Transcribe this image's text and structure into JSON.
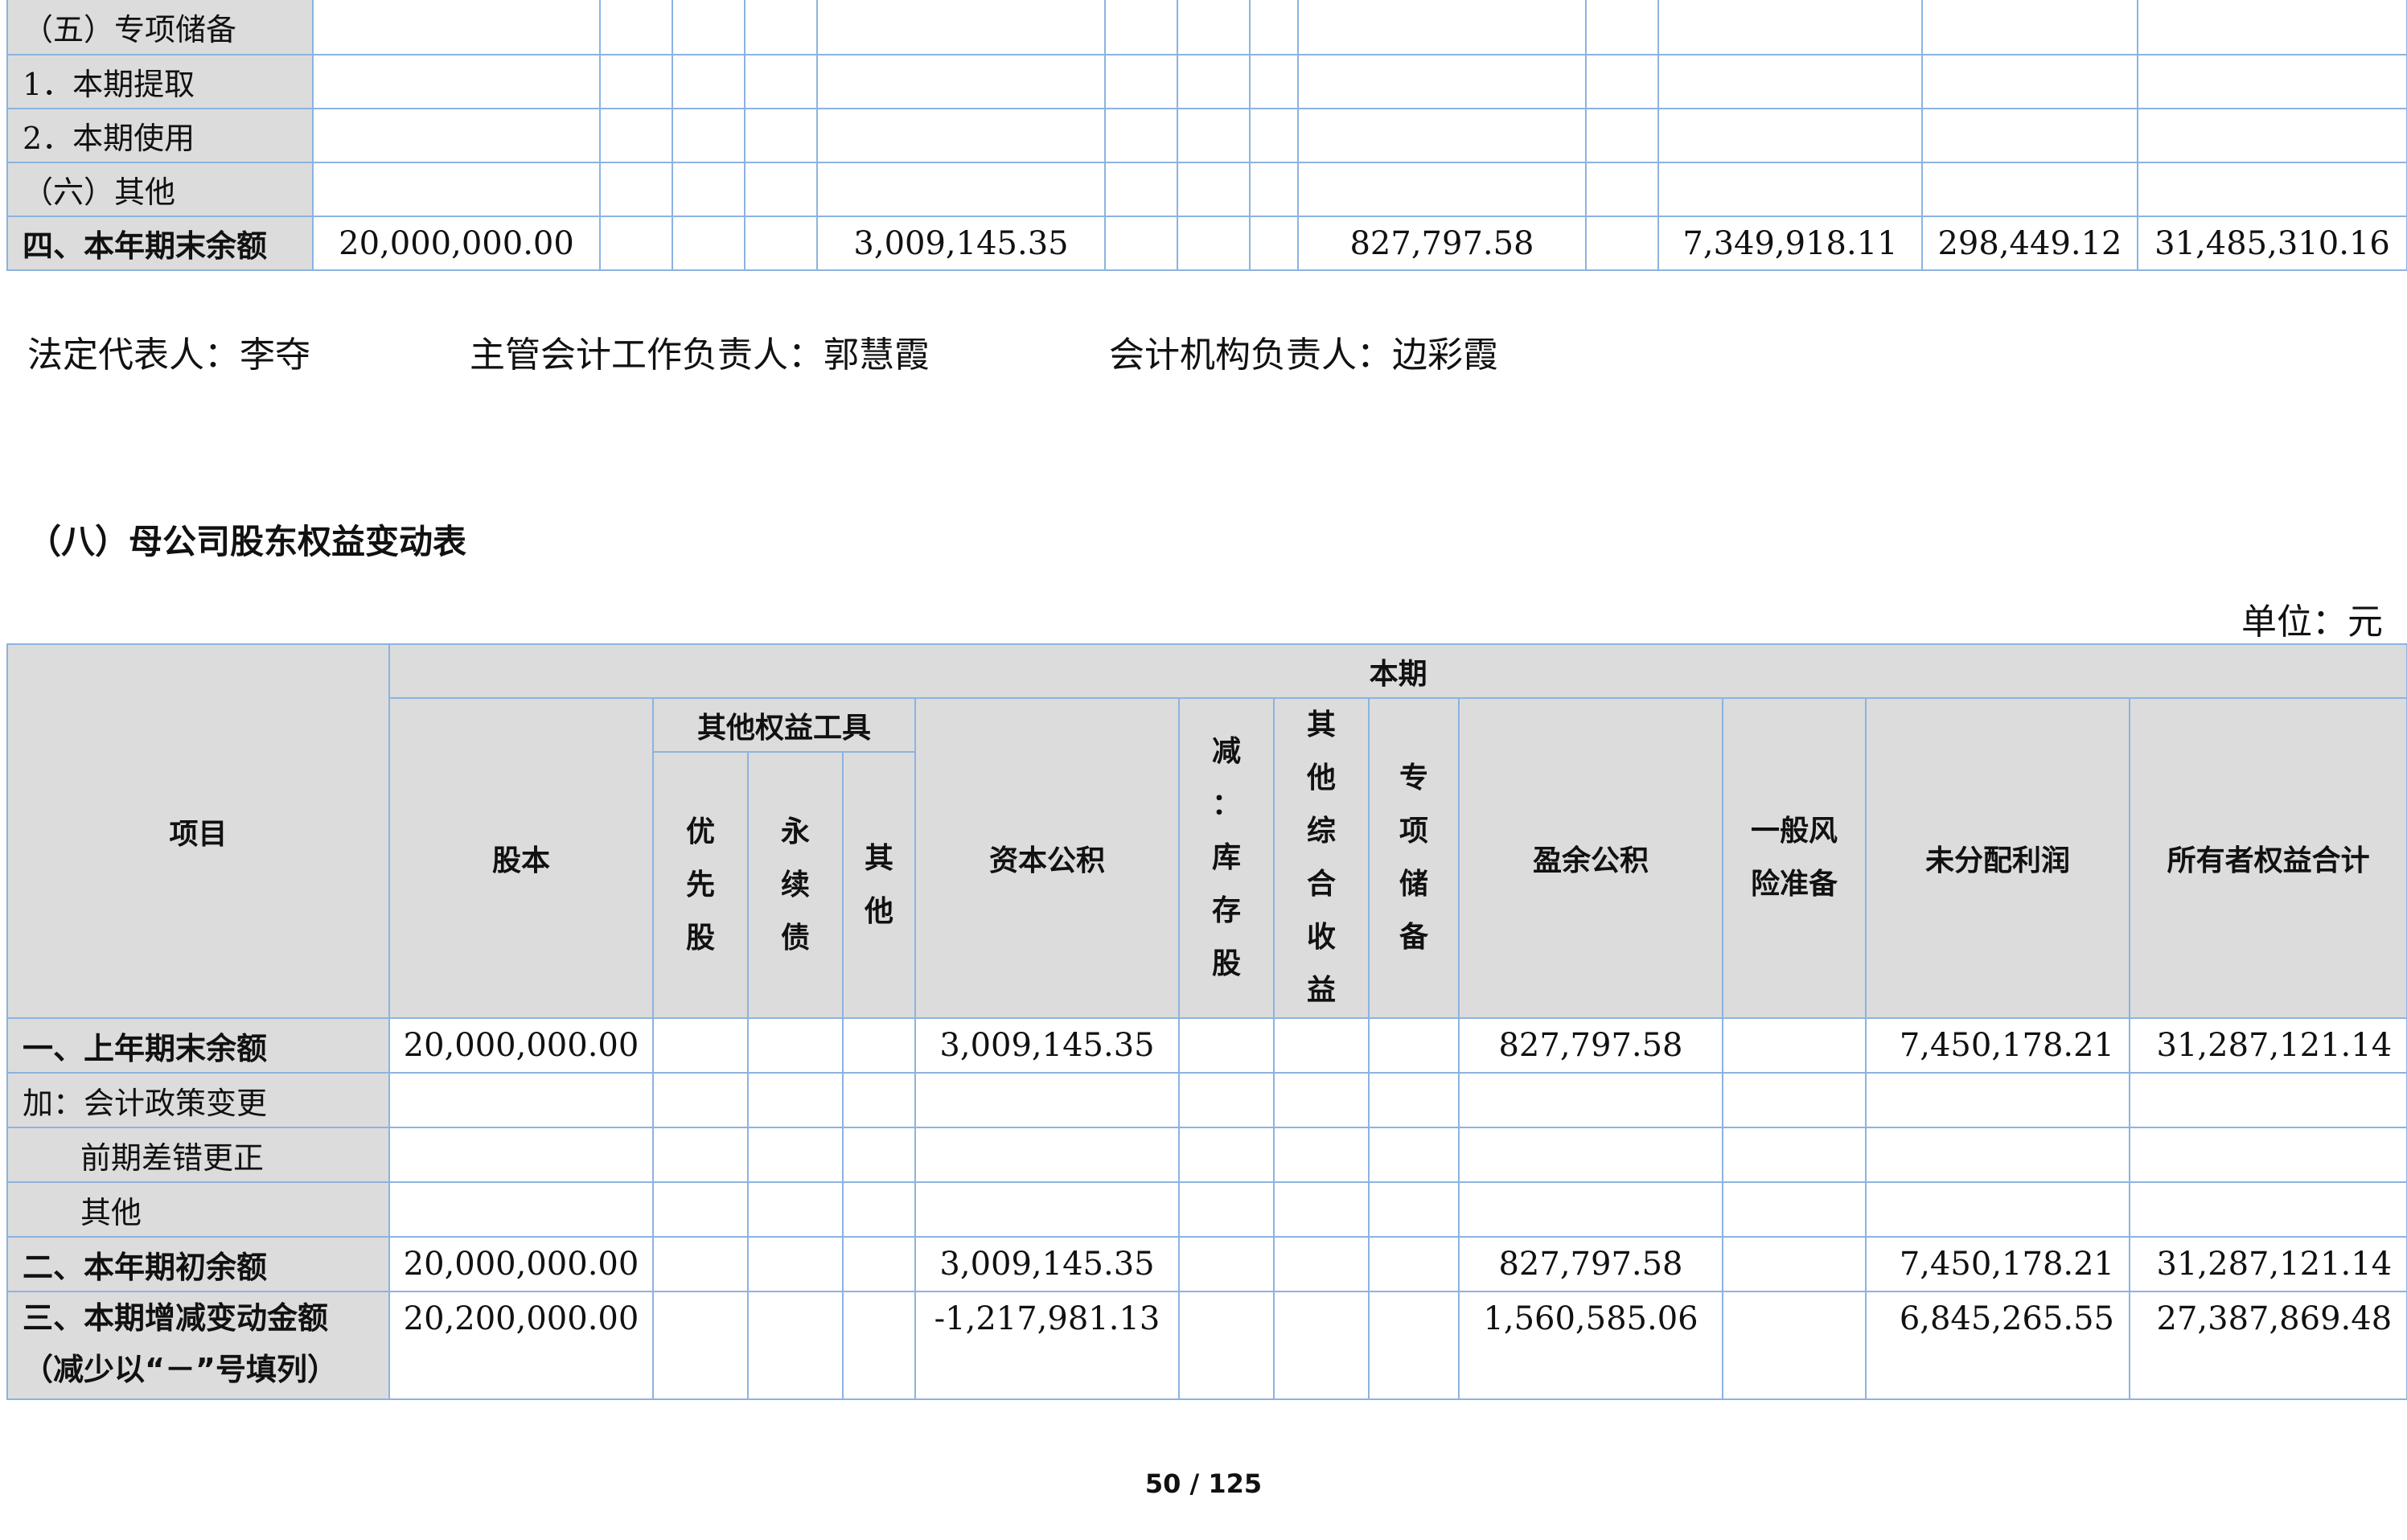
{
  "top_table": {
    "rows": [
      {
        "label": "（五）专项储备",
        "values": [
          "",
          "",
          "",
          "",
          "",
          "",
          "",
          "",
          "",
          "",
          "",
          "",
          ""
        ]
      },
      {
        "label": "1．本期提取",
        "values": [
          "",
          "",
          "",
          "",
          "",
          "",
          "",
          "",
          "",
          "",
          "",
          "",
          ""
        ]
      },
      {
        "label": "2．本期使用",
        "values": [
          "",
          "",
          "",
          "",
          "",
          "",
          "",
          "",
          "",
          "",
          "",
          "",
          ""
        ]
      },
      {
        "label": "（六）其他",
        "values": [
          "",
          "",
          "",
          "",
          "",
          "",
          "",
          "",
          "",
          "",
          "",
          "",
          ""
        ]
      },
      {
        "label": "四、本年期末余额",
        "values": [
          "20,000,000.00",
          "",
          "",
          "",
          "3,009,145.35",
          "",
          "",
          "",
          "827,797.58",
          "",
          "7,349,918.11",
          "298,449.12",
          "31,485,310.16"
        ]
      }
    ]
  },
  "signers": {
    "legal_rep": "法定代表人：李夺",
    "accounting_head": "主管会计工作负责人：郭慧霞",
    "accounting_org_head": "会计机构负责人：边彩霞"
  },
  "section": {
    "title": "（八）母公司股东权益变动表",
    "unit": "单位：元"
  },
  "main_table": {
    "headers": {
      "item": "项目",
      "period": "本期",
      "share_capital": "股本",
      "other_equity_tools": "其他权益工具",
      "preferred": "优\n先\n股",
      "perpetual": "永\n续\n债",
      "other_tool": "其\n他",
      "capital_reserve": "资本公积",
      "treasury": "减\n：\n库\n存\n股",
      "oci": "其\n他\n综\n合\n收\n益",
      "special_reserve": "专\n项\n储\n备",
      "surplus_reserve": "盈余公积",
      "general_risk": "一般风\n险准备",
      "undistributed": "未分配利润",
      "total_equity": "所有者权益合计"
    },
    "rows": [
      {
        "label": "一、上年期末余额",
        "values": [
          "20,000,000.00",
          "",
          "",
          "",
          "3,009,145.35",
          "",
          "",
          "",
          "827,797.58",
          "",
          "7,450,178.21",
          "31,287,121.14"
        ]
      },
      {
        "label": "加：会计政策变更",
        "values": [
          "",
          "",
          "",
          "",
          "",
          "",
          "",
          "",
          "",
          "",
          "",
          ""
        ]
      },
      {
        "label": "前期差错更正",
        "values": [
          "",
          "",
          "",
          "",
          "",
          "",
          "",
          "",
          "",
          "",
          "",
          ""
        ]
      },
      {
        "label": "其他",
        "values": [
          "",
          "",
          "",
          "",
          "",
          "",
          "",
          "",
          "",
          "",
          "",
          ""
        ]
      },
      {
        "label": "二、本年期初余额",
        "values": [
          "20,000,000.00",
          "",
          "",
          "",
          "3,009,145.35",
          "",
          "",
          "",
          "827,797.58",
          "",
          "7,450,178.21",
          "31,287,121.14"
        ]
      },
      {
        "label": "三、本期增减变动金额",
        "label2": "（减少以“－”号填列）",
        "values": [
          "20,200,000.00",
          "",
          "",
          "",
          "-1,217,981.13",
          "",
          "",
          "",
          "1,560,585.06",
          "",
          "6,845,265.55",
          "27,387,869.48"
        ]
      }
    ]
  },
  "page": {
    "indicator": "50 / 125"
  }
}
